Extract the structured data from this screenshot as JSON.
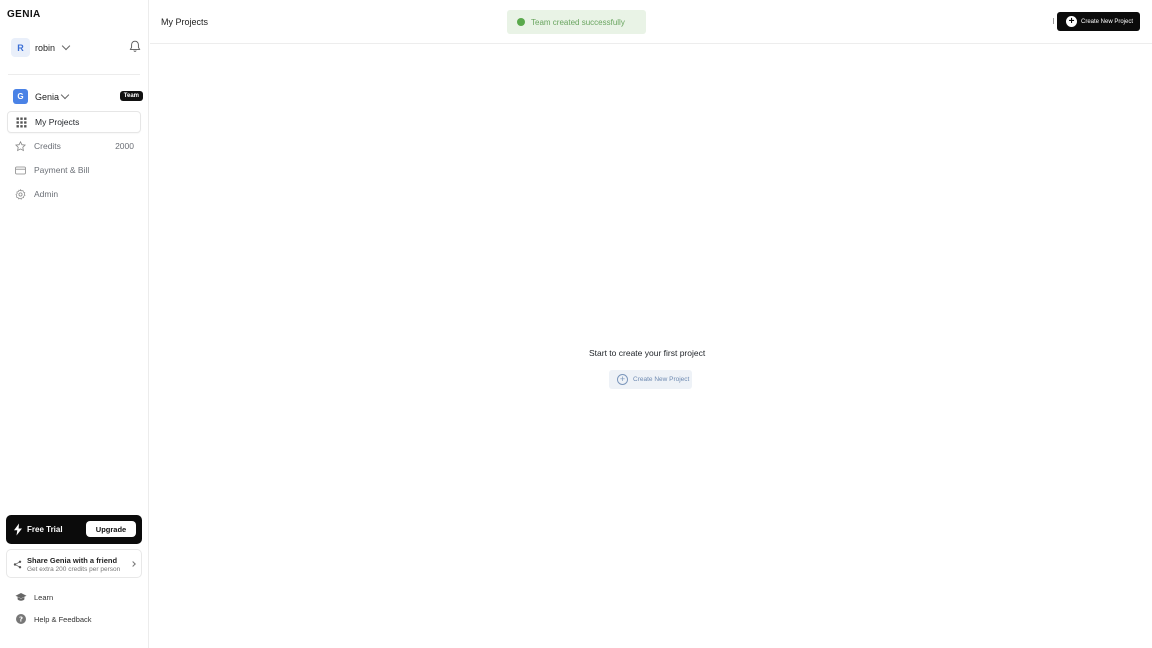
{
  "app": {
    "logo": "GENIA"
  },
  "user": {
    "initial": "R",
    "name": "robin"
  },
  "team": {
    "initial": "G",
    "name": "Genia",
    "badge": "Team"
  },
  "sidebar": {
    "items": [
      {
        "label": "My Projects",
        "icon": "grid-icon",
        "active": true
      },
      {
        "label": "Credits",
        "icon": "star-icon",
        "count": "2000"
      },
      {
        "label": "Payment & Bill",
        "icon": "card-icon"
      },
      {
        "label": "Admin",
        "icon": "gear-icon"
      }
    ]
  },
  "trial": {
    "label": "Free Trial",
    "upgrade_label": "Upgrade"
  },
  "share": {
    "title": "Share Genia with a friend",
    "subtitle": "Get extra 200 credits per person"
  },
  "bottom": {
    "learn": "Learn",
    "help": "Help & Feedback"
  },
  "header": {
    "title": "My Projects",
    "toast": "Team created successfully",
    "create_label": "Create New Project"
  },
  "main": {
    "empty_title": "Start to create your first project",
    "create_label": "Create New Project"
  },
  "colors": {
    "toast_bg": "#e9f3e6",
    "toast_dot": "#5aa94c",
    "accent_blue": "#4a82e6",
    "button_dark": "#0b0b0b"
  }
}
